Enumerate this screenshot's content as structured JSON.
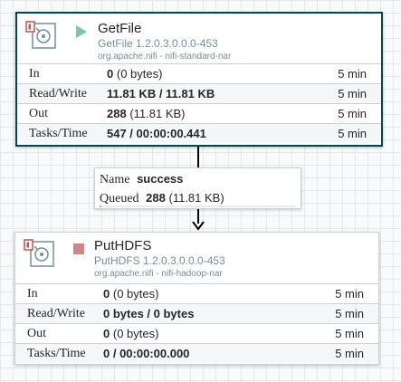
{
  "processors": [
    {
      "name": "GetFile",
      "type": "GetFile 1.2.0.3.0.0.0-453",
      "bundle": "org.apache.nifi - nifi-standard-nar",
      "state": "running",
      "state_icon": "play-icon",
      "state_color": "#7dc7a0",
      "selected": true,
      "stats": [
        {
          "label": "In",
          "value": "0",
          "detail": "(0 bytes)",
          "window": "5 min"
        },
        {
          "label": "Read/Write",
          "value": "11.81 KB / 11.81 KB",
          "detail": "",
          "window": "5 min"
        },
        {
          "label": "Out",
          "value": "288",
          "detail": "(11.81 KB)",
          "window": "5 min"
        },
        {
          "label": "Tasks/Time",
          "value": "547 / 00:00:00.441",
          "detail": "",
          "window": "5 min"
        }
      ]
    },
    {
      "name": "PutHDFS",
      "type": "PutHDFS 1.2.0.3.0.0.0-453",
      "bundle": "org.apache.nifi - nifi-hadoop-nar",
      "state": "stopped",
      "state_icon": "stop-icon",
      "state_color": "#d18686",
      "selected": false,
      "stats": [
        {
          "label": "In",
          "value": "0",
          "detail": "(0 bytes)",
          "window": "5 min"
        },
        {
          "label": "Read/Write",
          "value": "0 bytes / 0 bytes",
          "detail": "",
          "window": "5 min"
        },
        {
          "label": "Out",
          "value": "0",
          "detail": "(0 bytes)",
          "window": "5 min"
        },
        {
          "label": "Tasks/Time",
          "value": "0 / 00:00:00.000",
          "detail": "",
          "window": "5 min"
        }
      ]
    }
  ],
  "connection": {
    "name_label": "Name",
    "name_value": "success",
    "queued_label": "Queued",
    "queued_count": "288",
    "queued_size": "(11.81 KB)",
    "queue_fill": 0.01
  },
  "colors": {
    "selected_border": "#004849",
    "running": "#7dc7a0",
    "stopped": "#d18686",
    "processor_icon": "#728e9b"
  }
}
